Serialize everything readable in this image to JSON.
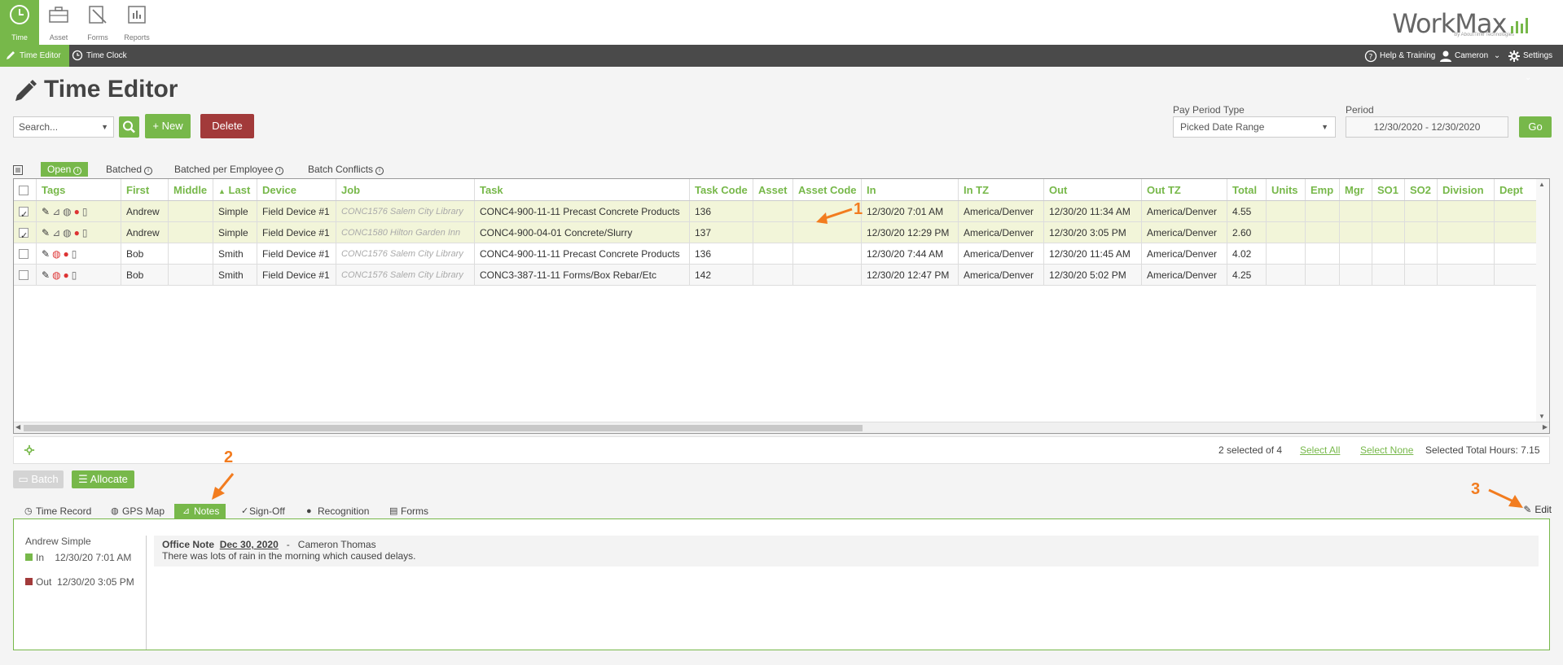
{
  "topnav": {
    "items": [
      {
        "label": "Time",
        "icon": "clock-icon"
      },
      {
        "label": "Asset",
        "icon": "briefcase-icon"
      },
      {
        "label": "Forms",
        "icon": "forms-icon"
      },
      {
        "label": "Reports",
        "icon": "reports-icon"
      }
    ],
    "logo": {
      "brand": "WorkMax",
      "sub": "By AboutTime Technologies"
    }
  },
  "subnav": {
    "tabs": [
      {
        "label": "Time Editor"
      },
      {
        "label": "Time Clock"
      }
    ],
    "help": "Help & Training",
    "user": "Cameron",
    "settings": "Settings"
  },
  "page": {
    "title": "Time Editor"
  },
  "toolbar": {
    "search_value": "Search...",
    "new_label": "+ New",
    "delete_label": "Delete",
    "pay_period_type_label": "Pay Period Type",
    "pay_period_type_value": "Picked Date Range",
    "period_label": "Period",
    "period_value": "12/30/2020 - 12/30/2020",
    "go_label": "Go"
  },
  "filter_tabs": [
    "Open",
    "Batched",
    "Batched per Employee",
    "Batch Conflicts"
  ],
  "grid": {
    "headers": [
      "Tags",
      "First",
      "Middle",
      "Last",
      "Device",
      "Job",
      "Task",
      "Task Code",
      "Asset",
      "Asset Code",
      "In",
      "In TZ",
      "Out",
      "Out TZ",
      "Total",
      "Units",
      "Emp",
      "Mgr",
      "SO1",
      "SO2",
      "Division",
      "Dept"
    ],
    "rows": [
      {
        "checked": true,
        "first": "Andrew",
        "middle": "",
        "last": "Simple",
        "device": "Field Device #1",
        "job": "CONC1576 Salem City Library",
        "task": "CONC4-900-11-11 Precast Concrete Products",
        "task_code": "136",
        "asset": "",
        "asset_code": "",
        "in": "12/30/20 7:01 AM",
        "in_tz": "America/Denver",
        "out": "12/30/20 11:34 AM",
        "out_tz": "America/Denver",
        "total": "4.55"
      },
      {
        "checked": true,
        "first": "Andrew",
        "middle": "",
        "last": "Simple",
        "device": "Field Device #1",
        "job": "CONC1580 Hilton Garden Inn",
        "task": "CONC4-900-04-01 Concrete/Slurry",
        "task_code": "137",
        "asset": "",
        "asset_code": "",
        "in": "12/30/20 12:29 PM",
        "in_tz": "America/Denver",
        "out": "12/30/20 3:05 PM",
        "out_tz": "America/Denver",
        "total": "2.60"
      },
      {
        "checked": false,
        "first": "Bob",
        "middle": "",
        "last": "Smith",
        "device": "Field Device #1",
        "job": "CONC1576 Salem City Library",
        "task": "CONC4-900-11-11 Precast Concrete Products",
        "task_code": "136",
        "asset": "",
        "asset_code": "",
        "in": "12/30/20 7:44 AM",
        "in_tz": "America/Denver",
        "out": "12/30/20 11:45 AM",
        "out_tz": "America/Denver",
        "total": "4.02"
      },
      {
        "checked": false,
        "first": "Bob",
        "middle": "",
        "last": "Smith",
        "device": "Field Device #1",
        "job": "CONC1576 Salem City Library",
        "task": "CONC3-387-11-11 Forms/Box Rebar/Etc",
        "task_code": "142",
        "asset": "",
        "asset_code": "",
        "in": "12/30/20 12:47 PM",
        "in_tz": "America/Denver",
        "out": "12/30/20 5:02 PM",
        "out_tz": "America/Denver",
        "total": "4.25"
      }
    ]
  },
  "annotations": [
    "1",
    "2",
    "3"
  ],
  "status": {
    "selected": "2 selected of 4",
    "select_all": "Select All",
    "select_none": "Select None",
    "total_hours": "Selected Total Hours: 7.15"
  },
  "actions": {
    "batch": "Batch",
    "allocate": "Allocate"
  },
  "detail_tabs": [
    "Time Record",
    "GPS Map",
    "Notes",
    "Sign-Off",
    "Recognition",
    "Forms"
  ],
  "detail": {
    "edit": "Edit",
    "employee": "Andrew Simple",
    "in_label": "In",
    "in_time": "12/30/20 7:01 AM",
    "out_label": "Out",
    "out_time": "12/30/20 3:05 PM",
    "note_type": "Office Note",
    "note_date": "Dec 30, 2020",
    "note_sep": "-",
    "note_author": "Cameron Thomas",
    "note_text": "There was lots of rain in the morning which caused delays."
  },
  "colors": {
    "accent": "#77b84a",
    "danger": "#a23a3a",
    "annotation": "#f27c1f",
    "in": "#77b84a",
    "out": "#a23a3a"
  }
}
